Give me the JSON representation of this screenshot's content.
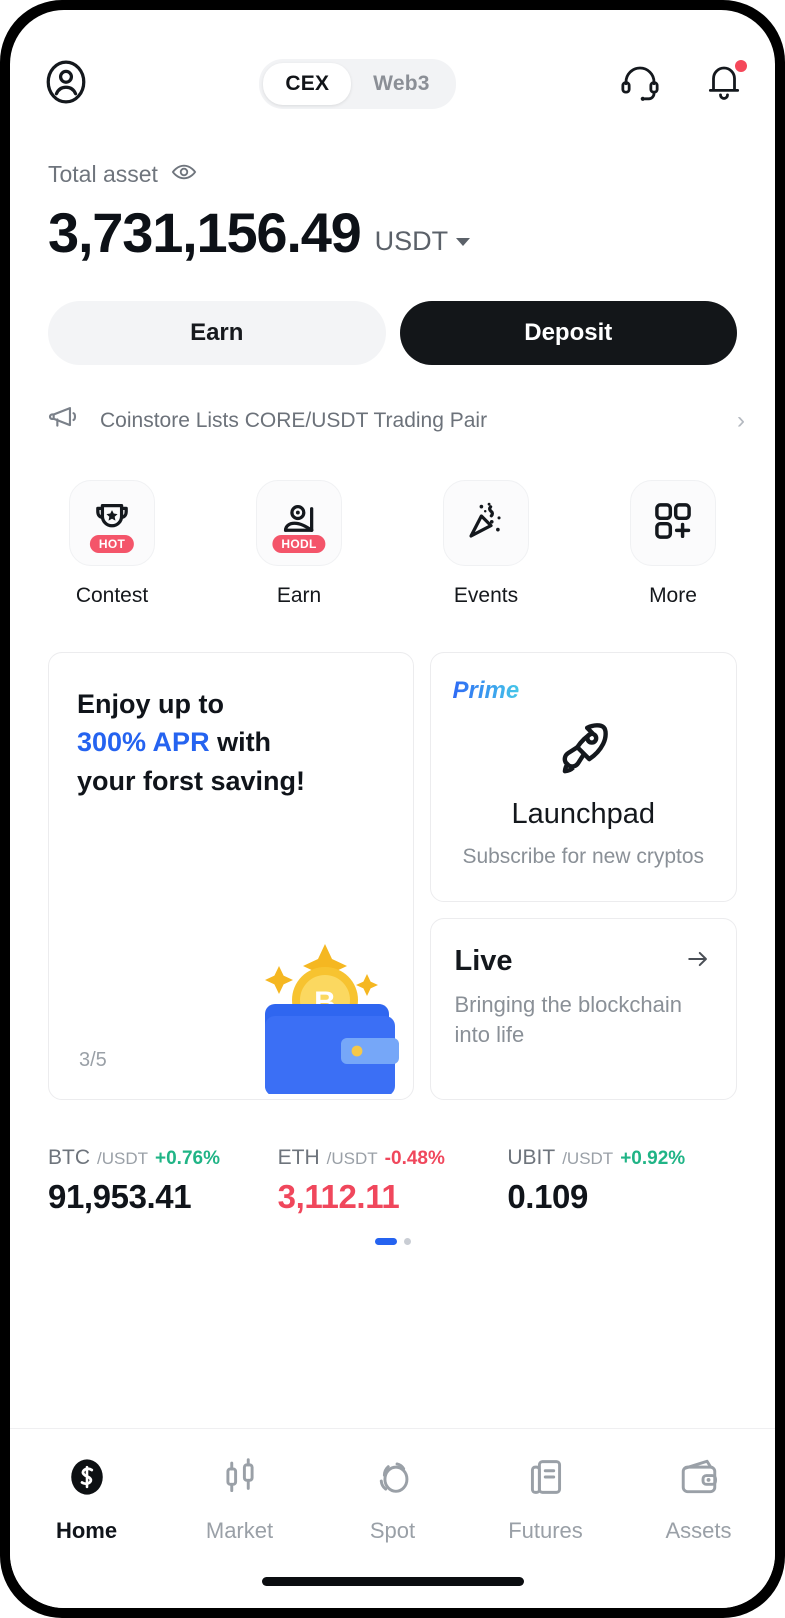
{
  "header": {
    "profile_icon": "user-circle-icon",
    "tabs": [
      {
        "label": "CEX",
        "active": true
      },
      {
        "label": "Web3",
        "active": false
      }
    ],
    "support_icon": "headset-icon",
    "notification_icon": "bell-icon",
    "has_notification": true
  },
  "balance": {
    "label": "Total asset",
    "eye_icon": "eye-icon",
    "amount": "3,731,156.49",
    "currency": "USDT"
  },
  "actions": {
    "earn_label": "Earn",
    "deposit_label": "Deposit"
  },
  "announcement": {
    "icon": "megaphone-icon",
    "text": "Coinstore Lists CORE/USDT Trading Pair",
    "chevron": "›"
  },
  "quick_entries": [
    {
      "label": "Contest",
      "icon": "trophy-icon",
      "badge": "HOT"
    },
    {
      "label": "Earn",
      "icon": "lounging-person-icon",
      "badge": "HODL"
    },
    {
      "label": "Events",
      "icon": "party-popper-icon",
      "badge": ""
    },
    {
      "label": "More",
      "icon": "grid-plus-icon",
      "badge": ""
    }
  ],
  "promo_card": {
    "line1": "Enjoy up to",
    "highlight": "300% APR",
    "line2_rest": " with",
    "line3": "your forst saving!",
    "counter_current": "3",
    "counter_total": "/5",
    "art": "wallet-bitcoin-illustration"
  },
  "prime_card": {
    "tag": "Prime",
    "icon": "rocket-icon",
    "title": "Launchpad",
    "subtitle": "Subscribe for new cryptos"
  },
  "live_card": {
    "title": "Live",
    "arrow_icon": "arrow-right-icon",
    "subtitle": "Bringing the blockchain into life"
  },
  "tickers": [
    {
      "base": "BTC",
      "quote": "/USDT",
      "change": "+0.76%",
      "direction": "up",
      "price": "91,953.41"
    },
    {
      "base": "ETH",
      "quote": "/USDT",
      "change": "-0.48%",
      "direction": "down",
      "price": "3,112.11"
    },
    {
      "base": "UBIT",
      "quote": "/USDT",
      "change": "+0.92%",
      "direction": "up",
      "price": "0.109"
    }
  ],
  "carousel": {
    "pages": 2,
    "active": 0
  },
  "bottom_nav": [
    {
      "label": "Home",
      "icon": "coinstore-logo-icon",
      "active": true
    },
    {
      "label": "Market",
      "icon": "candlestick-icon",
      "active": false
    },
    {
      "label": "Spot",
      "icon": "spot-swap-icon",
      "active": false
    },
    {
      "label": "Futures",
      "icon": "document-icon",
      "active": false
    },
    {
      "label": "Assets",
      "icon": "wallet-icon",
      "active": false
    }
  ],
  "colors": {
    "accent_blue": "#2563f0",
    "up_green": "#20b486",
    "down_red": "#f0475c",
    "badge_red": "#f4556a",
    "dark": "#131619"
  }
}
